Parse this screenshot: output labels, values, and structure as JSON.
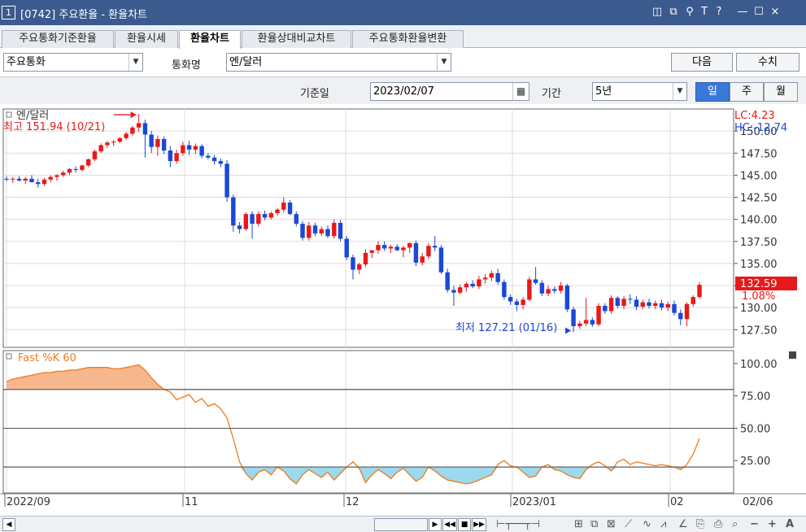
{
  "window": {
    "number": "1",
    "title": "[0742] 주요환율 - 환율차트",
    "icons": [
      "restore-icon",
      "copy-icon",
      "pin-icon",
      "font-icon",
      "help-icon",
      "minimize-icon",
      "maximize-icon",
      "close-icon"
    ],
    "icon_glyphs": [
      "◫",
      "⧉",
      "⚲",
      "T",
      "?",
      "—",
      "☐",
      "×"
    ]
  },
  "tabs": [
    {
      "label": "주요통화기준환율",
      "active": false
    },
    {
      "label": "환율시세",
      "active": false
    },
    {
      "label": "환율차트",
      "active": true
    },
    {
      "label": "환율상대비교차트",
      "active": false
    },
    {
      "label": "주요통화환율변환",
      "active": false
    }
  ],
  "controls": {
    "group_value": "주요통화",
    "currency_label": "통화명",
    "currency_value": "엔/달러",
    "next_button": "다음",
    "query_button": "수치",
    "date_label": "기준일",
    "date_value": "2023/02/07",
    "period_label": "기간",
    "period_value": "5년",
    "periods": [
      {
        "label": "일",
        "active": true
      },
      {
        "label": "주",
        "active": false
      },
      {
        "label": "월",
        "active": false
      }
    ]
  },
  "colors": {
    "up": "#e8191a",
    "down": "#1a48d8",
    "fastk": "#f07b1c",
    "fill_high": "#f6b78f",
    "fill_low": "#9cd8ee",
    "title_bar": "#3b5b8e",
    "accent": "#3a78d8"
  },
  "chart_data": [
    {
      "type": "candlestick",
      "title": "엔/달러",
      "lc_label": "LC:4.23",
      "hc_label": "HC:-12.74",
      "high_label": "최고 151.94 (10/21)",
      "low_label": "최저 127.21 (01/16)",
      "last_value": "132.59",
      "change_pct": "1.08%",
      "ylim": [
        125.5,
        152.5
      ],
      "yticks": [
        "150.00",
        "147.50",
        "145.00",
        "142.50",
        "140.00",
        "137.50",
        "135.00",
        "132.50",
        "130.00",
        "127.50"
      ],
      "ytick_values": [
        150,
        147.5,
        145,
        142.5,
        140,
        137.5,
        135,
        132.5,
        130,
        127.5
      ],
      "x_labels": [
        "2022/09",
        "11",
        "12",
        "2023/01",
        "02",
        "02/06"
      ],
      "ohlc": [
        [
          144.6,
          144.9,
          144.3,
          144.5
        ],
        [
          144.5,
          144.8,
          144.1,
          144.6
        ],
        [
          144.6,
          144.9,
          144.3,
          144.4
        ],
        [
          144.4,
          144.8,
          144.0,
          144.6
        ],
        [
          144.6,
          145.0,
          144.3,
          144.2
        ],
        [
          144.2,
          144.6,
          143.6,
          144.0
        ],
        [
          144.0,
          144.7,
          143.8,
          144.5
        ],
        [
          144.5,
          145.0,
          144.2,
          144.8
        ],
        [
          144.8,
          145.1,
          144.4,
          145.0
        ],
        [
          145.0,
          145.5,
          144.8,
          145.3
        ],
        [
          145.3,
          145.8,
          145.0,
          145.7
        ],
        [
          145.7,
          146.0,
          145.3,
          145.6
        ],
        [
          145.6,
          146.2,
          145.4,
          146.1
        ],
        [
          146.1,
          146.9,
          145.9,
          146.8
        ],
        [
          146.8,
          147.9,
          146.6,
          147.7
        ],
        [
          147.7,
          148.6,
          147.5,
          148.4
        ],
        [
          148.4,
          148.9,
          148.1,
          148.7
        ],
        [
          148.7,
          149.0,
          148.3,
          148.8
        ],
        [
          148.8,
          149.3,
          148.6,
          149.2
        ],
        [
          149.2,
          149.9,
          149.0,
          149.7
        ],
        [
          149.7,
          150.6,
          149.5,
          150.4
        ],
        [
          150.4,
          151.94,
          149.9,
          150.9
        ],
        [
          150.9,
          151.3,
          147.0,
          149.6
        ],
        [
          149.6,
          150.0,
          147.5,
          148.2
        ],
        [
          148.2,
          149.5,
          147.2,
          149.1
        ],
        [
          149.1,
          149.4,
          147.4,
          147.8
        ],
        [
          147.8,
          148.3,
          145.9,
          146.6
        ],
        [
          146.6,
          147.9,
          146.3,
          147.5
        ],
        [
          147.5,
          148.8,
          147.2,
          148.4
        ],
        [
          148.4,
          148.9,
          147.3,
          147.9
        ],
        [
          147.9,
          148.6,
          147.4,
          148.3
        ],
        [
          148.3,
          148.5,
          146.9,
          147.2
        ],
        [
          147.2,
          147.5,
          146.8,
          147.0
        ],
        [
          147.0,
          147.3,
          146.2,
          146.6
        ],
        [
          146.6,
          146.9,
          145.9,
          146.3
        ],
        [
          146.3,
          146.7,
          142.0,
          142.5
        ],
        [
          142.5,
          142.8,
          138.6,
          139.3
        ],
        [
          139.3,
          139.7,
          138.4,
          138.9
        ],
        [
          138.9,
          140.8,
          138.7,
          140.6
        ],
        [
          140.6,
          140.9,
          137.8,
          139.5
        ],
        [
          139.5,
          140.9,
          139.2,
          140.6
        ],
        [
          140.6,
          141.0,
          139.9,
          140.2
        ],
        [
          140.2,
          140.9,
          140.0,
          140.7
        ],
        [
          140.7,
          141.3,
          140.4,
          141.1
        ],
        [
          141.1,
          142.5,
          140.8,
          141.9
        ],
        [
          141.9,
          142.2,
          140.5,
          140.6
        ],
        [
          140.6,
          140.9,
          139.2,
          139.5
        ],
        [
          139.5,
          139.8,
          137.6,
          137.9
        ],
        [
          137.9,
          139.7,
          137.6,
          139.3
        ],
        [
          139.3,
          139.6,
          138.1,
          138.4
        ],
        [
          138.4,
          139.2,
          138.1,
          138.9
        ],
        [
          138.9,
          139.3,
          137.9,
          138.1
        ],
        [
          138.1,
          140.0,
          137.8,
          139.6
        ],
        [
          139.6,
          139.9,
          137.5,
          137.8
        ],
        [
          137.8,
          138.1,
          135.4,
          135.7
        ],
        [
          135.7,
          136.0,
          133.2,
          134.3
        ],
        [
          134.3,
          135.1,
          133.8,
          134.9
        ],
        [
          134.9,
          136.6,
          134.6,
          136.2
        ],
        [
          136.2,
          136.5,
          135.6,
          136.5
        ],
        [
          136.5,
          137.5,
          136.1,
          137.1
        ],
        [
          137.1,
          137.5,
          136.4,
          136.7
        ],
        [
          136.7,
          137.1,
          136.2,
          136.9
        ],
        [
          136.9,
          137.2,
          136.4,
          136.5
        ],
        [
          136.5,
          137.0,
          135.7,
          136.8
        ],
        [
          136.8,
          137.4,
          136.2,
          137.3
        ],
        [
          137.3,
          137.6,
          134.7,
          135.1
        ],
        [
          135.1,
          136.2,
          134.8,
          135.8
        ],
        [
          135.8,
          137.3,
          135.5,
          137.0
        ],
        [
          137.0,
          138.1,
          136.4,
          136.8
        ],
        [
          136.8,
          137.1,
          133.8,
          134.0
        ],
        [
          134.0,
          134.4,
          131.7,
          132.0
        ],
        [
          132.0,
          132.5,
          130.2,
          131.7
        ],
        [
          131.7,
          132.6,
          131.5,
          132.3
        ],
        [
          132.3,
          132.9,
          131.8,
          132.7
        ],
        [
          132.7,
          133.1,
          132.2,
          132.4
        ],
        [
          132.4,
          133.6,
          132.1,
          133.2
        ],
        [
          133.2,
          133.8,
          132.7,
          133.4
        ],
        [
          133.4,
          134.2,
          133.0,
          133.9
        ],
        [
          133.9,
          134.4,
          132.6,
          132.9
        ],
        [
          132.9,
          133.2,
          130.9,
          131.2
        ],
        [
          131.2,
          131.5,
          130.3,
          130.7
        ],
        [
          130.7,
          131.0,
          129.6,
          130.3
        ],
        [
          130.3,
          131.2,
          129.8,
          130.9
        ],
        [
          130.9,
          133.5,
          130.7,
          133.2
        ],
        [
          133.2,
          134.6,
          132.6,
          132.8
        ],
        [
          132.8,
          133.1,
          131.3,
          131.6
        ],
        [
          131.6,
          132.5,
          131.3,
          132.1
        ],
        [
          132.1,
          132.4,
          131.6,
          131.9
        ],
        [
          131.9,
          132.9,
          131.6,
          132.5
        ],
        [
          132.5,
          132.7,
          129.5,
          129.8
        ],
        [
          129.8,
          130.1,
          127.21,
          127.9
        ],
        [
          127.9,
          128.5,
          127.6,
          128.2
        ],
        [
          128.2,
          131.1,
          127.9,
          128.6
        ],
        [
          128.6,
          128.9,
          127.8,
          128.1
        ],
        [
          128.1,
          130.5,
          127.9,
          130.2
        ],
        [
          130.2,
          130.5,
          129.3,
          129.6
        ],
        [
          129.6,
          131.4,
          129.3,
          131.1
        ],
        [
          131.1,
          131.3,
          129.9,
          130.2
        ],
        [
          130.2,
          131.3,
          129.8,
          131.0
        ],
        [
          131.0,
          131.5,
          130.4,
          130.9
        ],
        [
          130.9,
          131.3,
          129.7,
          130.1
        ],
        [
          130.1,
          130.9,
          129.8,
          130.6
        ],
        [
          130.6,
          131.0,
          129.9,
          130.2
        ],
        [
          130.2,
          130.8,
          129.8,
          130.5
        ],
        [
          130.5,
          130.9,
          129.7,
          130.0
        ],
        [
          130.0,
          130.7,
          129.6,
          130.4
        ],
        [
          130.4,
          130.8,
          129.1,
          129.4
        ],
        [
          129.4,
          129.8,
          128.0,
          128.7
        ],
        [
          128.7,
          130.6,
          127.9,
          130.4
        ],
        [
          130.4,
          131.4,
          130.1,
          131.2
        ],
        [
          131.2,
          132.9,
          131.0,
          132.59
        ]
      ]
    },
    {
      "type": "line",
      "title": "Fast %K 60",
      "ylim": [
        0,
        110
      ],
      "yticks": [
        "100.00",
        "75.00",
        "50.00",
        "25.00"
      ],
      "ytick_values": [
        100,
        75,
        50,
        25
      ],
      "reference_lines": [
        80,
        50,
        20
      ],
      "values": [
        86,
        88,
        89,
        90,
        91,
        92,
        93,
        93,
        94,
        94,
        95,
        95,
        96,
        97,
        97,
        97,
        97,
        96,
        96,
        97,
        98,
        99,
        95,
        89,
        84,
        80,
        78,
        72,
        74,
        76,
        70,
        73,
        67,
        69,
        65,
        58,
        42,
        24,
        15,
        10,
        16,
        18,
        14,
        20,
        17,
        11,
        7,
        14,
        18,
        15,
        12,
        16,
        10,
        15,
        20,
        24,
        19,
        8,
        14,
        18,
        15,
        11,
        16,
        19,
        14,
        9,
        12,
        20,
        17,
        13,
        10,
        9,
        8,
        7,
        8,
        10,
        12,
        14,
        22,
        25,
        21,
        20,
        16,
        12,
        13,
        20,
        22,
        18,
        17,
        14,
        12,
        11,
        18,
        22,
        24,
        21,
        17,
        24,
        26,
        22,
        24,
        23,
        22,
        21,
        22,
        21,
        20,
        18,
        22,
        30,
        42
      ]
    }
  ]
}
